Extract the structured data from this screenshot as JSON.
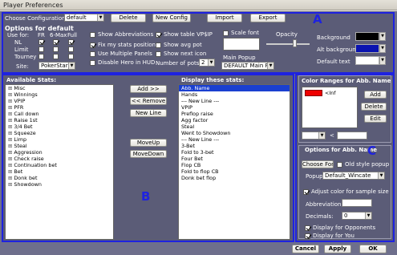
{
  "window": {
    "title": "Player Preferences"
  },
  "config_bar": {
    "choose_label": "Choose Configuration:",
    "config_value": "default",
    "delete_label": "Delete",
    "new_config_label": "New Config",
    "import_label": "Import",
    "export_label": "Export",
    "region_letter": "A"
  },
  "options_default": {
    "title": "Options for default",
    "use_for_label": "Use for:",
    "col_fr": "FR",
    "col_6max": "6-Max",
    "col_full": "Full",
    "row_nl": "NL",
    "row_limit": "Limit",
    "row_tourney": "Tourney",
    "site_label": "Site:",
    "site_value": "PokerStars",
    "show_abbreviations": "Show Abbreviations",
    "fix_my_stats": "Fix my stats position",
    "use_multiple_panels": "Use Multiple Panels",
    "disable_hero": "Disable Hero in HUD",
    "show_table_vpip": "Show table VP$IP",
    "show_avg_pot": "Show avg pot",
    "show_next_icon": "Show next icon",
    "number_of_pots_label": "Number of pots:",
    "number_of_pots_value": "2",
    "scale_font": "Scale font",
    "opacity_label": "Opacity",
    "opacity_value": 0.65,
    "main_popup_label": "Main Popup",
    "main_popup_value": "DEFAULT Main Popup",
    "background_label": "Background",
    "alt_background_label": "Alt background",
    "default_text_label": "Default text",
    "background_color": "#000000",
    "alt_background_color": "#0a13b0",
    "default_text_color": "#ffffff"
  },
  "available_stats": {
    "title": "Available Stats:",
    "items": [
      "Misc",
      "Winnings",
      "VPIP",
      "PFR",
      "Call down",
      "Raise 1st",
      "3/4 Bet",
      "Squeeze",
      "Limp",
      "Steal",
      "Aggression",
      "Check raise",
      "Continuation bet",
      "Bet",
      "Donk bet",
      "Showdown"
    ]
  },
  "transfer_buttons": {
    "add": "Add >>",
    "remove": "<< Remove",
    "new_line": "New Line",
    "move_up": "MoveUp",
    "move_down": "MoveDown",
    "region_letter": "B"
  },
  "display_stats": {
    "title": "Display these stats:",
    "items": [
      "Abb. Name",
      "Hands",
      "--- New Line ---",
      "VPIP",
      "Preflop raise",
      "Agg factor",
      "Steal",
      "Went to Showdown",
      "--- New Line ---",
      "3-Bet",
      "Fold to 3-bet",
      "Four Bet",
      "Flop CB",
      "Fold to flop CB",
      "Donk bet flop"
    ]
  },
  "color_ranges": {
    "title": "Color Ranges for Abb. Name",
    "entry_text": "<Inf",
    "add": "Add",
    "delete": "Delete",
    "edit": "Edit",
    "less_than": "<"
  },
  "options_abb": {
    "title": "Options for Abb. Name",
    "choose_font": "Choose Font",
    "old_style_popup": "Old style popup",
    "popup_label": "Popup",
    "popup_value": "Default_Wincate",
    "adjust_color": "Adjust color for sample size",
    "abbreviation_label": "Abbreviation:",
    "decimals_label": "Decimals:",
    "decimals_value": "0",
    "display_opponents": "Display for Opponents",
    "display_you": "Display for You",
    "region_letter": "C"
  },
  "footer": {
    "cancel": "Cancel",
    "apply": "Apply",
    "ok": "OK"
  }
}
